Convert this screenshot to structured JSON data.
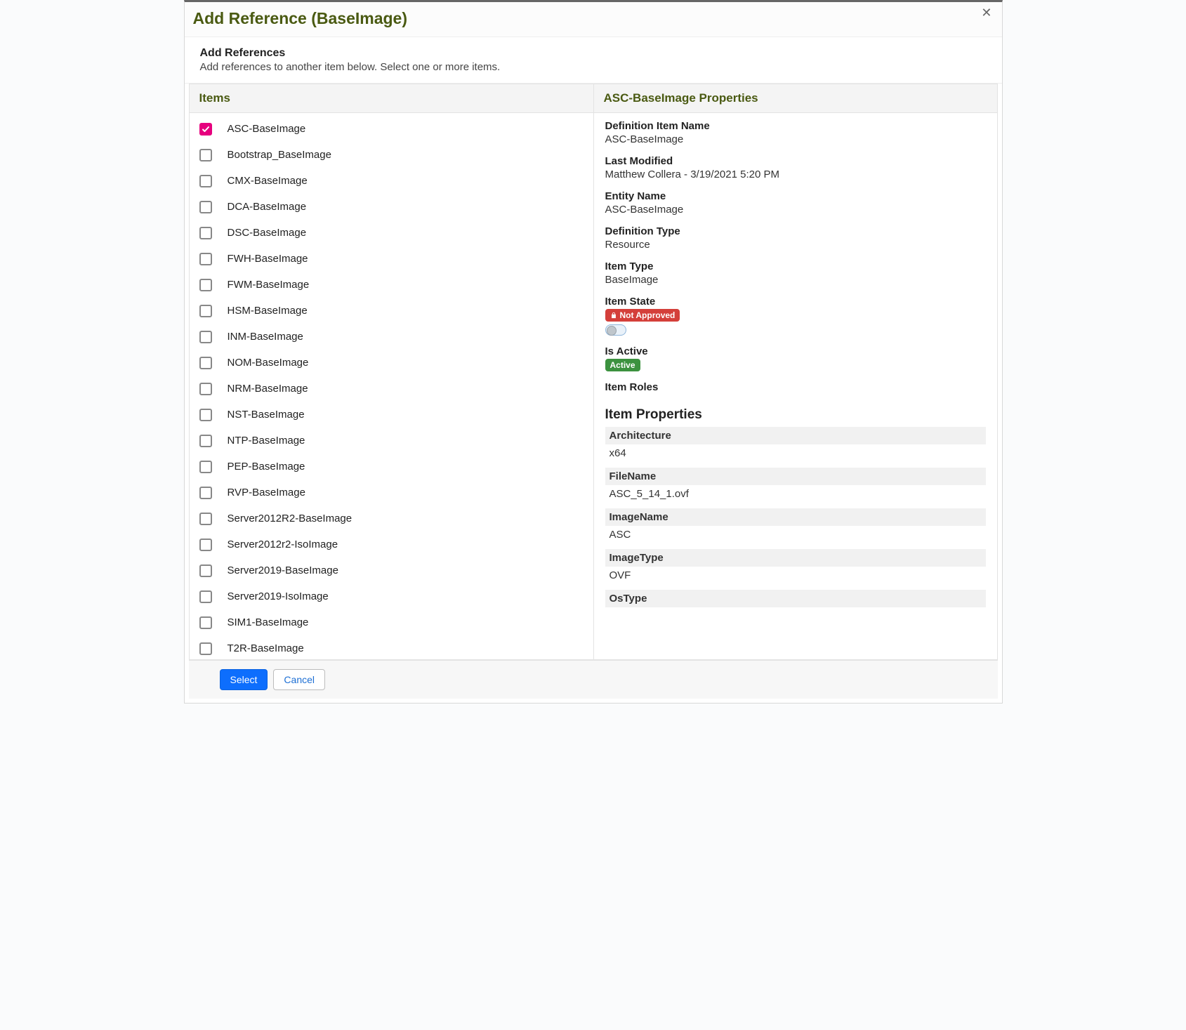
{
  "modal": {
    "title": "Add Reference (BaseImage)",
    "sub_title": "Add References",
    "sub_desc": "Add references to another item below. Select one or more items."
  },
  "items_panel": {
    "title": "Items",
    "list": [
      {
        "name": "ASC-BaseImage",
        "selected": true
      },
      {
        "name": "Bootstrap_BaseImage",
        "selected": false
      },
      {
        "name": "CMX-BaseImage",
        "selected": false
      },
      {
        "name": "DCA-BaseImage",
        "selected": false
      },
      {
        "name": "DSC-BaseImage",
        "selected": false
      },
      {
        "name": "FWH-BaseImage",
        "selected": false
      },
      {
        "name": "FWM-BaseImage",
        "selected": false
      },
      {
        "name": "HSM-BaseImage",
        "selected": false
      },
      {
        "name": "INM-BaseImage",
        "selected": false
      },
      {
        "name": "NOM-BaseImage",
        "selected": false
      },
      {
        "name": "NRM-BaseImage",
        "selected": false
      },
      {
        "name": "NST-BaseImage",
        "selected": false
      },
      {
        "name": "NTP-BaseImage",
        "selected": false
      },
      {
        "name": "PEP-BaseImage",
        "selected": false
      },
      {
        "name": "RVP-BaseImage",
        "selected": false
      },
      {
        "name": "Server2012R2-BaseImage",
        "selected": false
      },
      {
        "name": "Server2012r2-IsoImage",
        "selected": false
      },
      {
        "name": "Server2019-BaseImage",
        "selected": false
      },
      {
        "name": "Server2019-IsoImage",
        "selected": false
      },
      {
        "name": "SIM1-BaseImage",
        "selected": false
      },
      {
        "name": "T2R-BaseImage",
        "selected": false
      }
    ]
  },
  "props_panel": {
    "title": "ASC-BaseImage Properties",
    "fields": {
      "def_item_name_label": "Definition Item Name",
      "def_item_name_value": "ASC-BaseImage",
      "last_modified_label": "Last Modified",
      "last_modified_value": "Matthew Collera - 3/19/2021 5:20 PM",
      "entity_name_label": "Entity Name",
      "entity_name_value": "ASC-BaseImage",
      "def_type_label": "Definition Type",
      "def_type_value": "Resource",
      "item_type_label": "Item Type",
      "item_type_value": "BaseImage",
      "item_state_label": "Item State",
      "item_state_badge": "Not Approved",
      "is_active_label": "Is Active",
      "is_active_badge": "Active",
      "item_roles_label": "Item Roles",
      "item_props_header": "Item Properties",
      "kv": [
        {
          "k": "Architecture",
          "v": "x64"
        },
        {
          "k": "FileName",
          "v": "ASC_5_14_1.ovf"
        },
        {
          "k": "ImageName",
          "v": "ASC"
        },
        {
          "k": "ImageType",
          "v": "OVF"
        },
        {
          "k": "OsType",
          "v": ""
        }
      ]
    }
  },
  "footer": {
    "select": "Select",
    "cancel": "Cancel"
  }
}
